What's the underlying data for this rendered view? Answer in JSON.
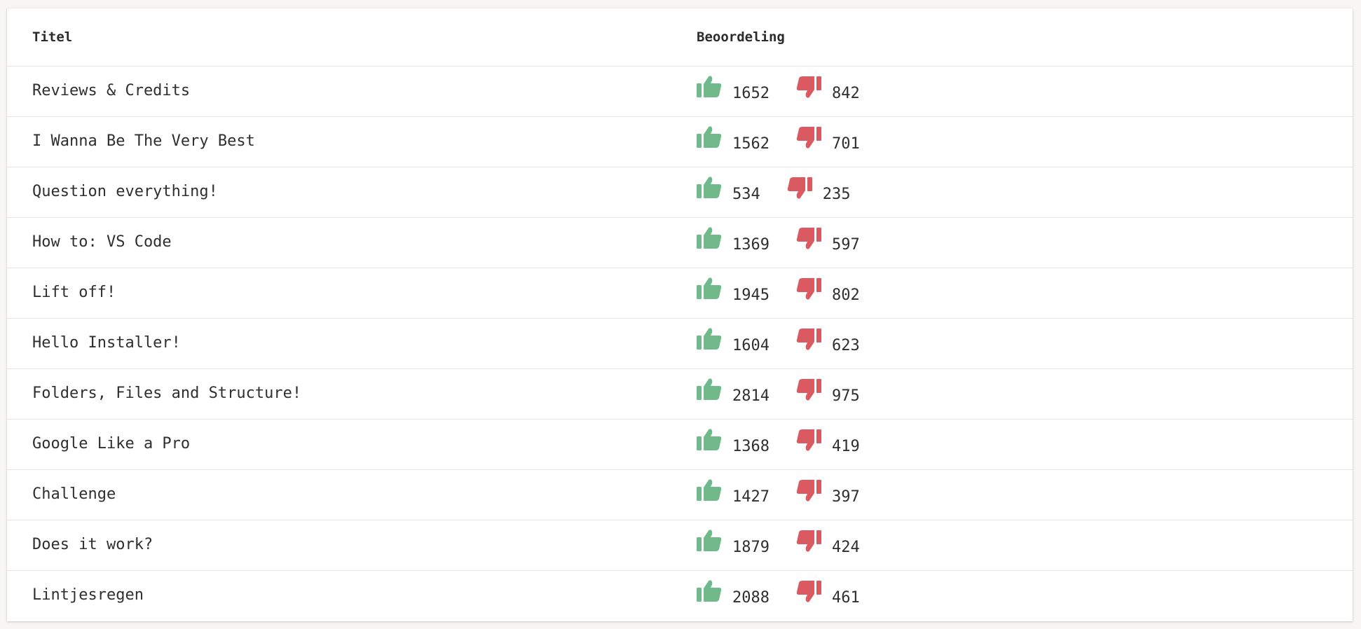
{
  "table": {
    "columns": {
      "title": "Titel",
      "rating": "Beoordeling"
    },
    "colors": {
      "like": "#71b98b",
      "dislike": "#db5a62"
    },
    "rows": [
      {
        "title": "Reviews & Credits",
        "likes": "1652",
        "dislikes": "842"
      },
      {
        "title": "I Wanna Be The Very Best",
        "likes": "1562",
        "dislikes": "701"
      },
      {
        "title": "Question everything!",
        "likes": "534",
        "dislikes": "235"
      },
      {
        "title": "How to: VS Code",
        "likes": "1369",
        "dislikes": "597"
      },
      {
        "title": "Lift off!",
        "likes": "1945",
        "dislikes": "802"
      },
      {
        "title": "Hello Installer!",
        "likes": "1604",
        "dislikes": "623"
      },
      {
        "title": "Folders, Files and Structure!",
        "likes": "2814",
        "dislikes": "975"
      },
      {
        "title": "Google Like a Pro",
        "likes": "1368",
        "dislikes": "419"
      },
      {
        "title": "Challenge",
        "likes": "1427",
        "dislikes": "397"
      },
      {
        "title": "Does it work?",
        "likes": "1879",
        "dislikes": "424"
      },
      {
        "title": "Lintjesregen",
        "likes": "2088",
        "dislikes": "461"
      }
    ]
  }
}
